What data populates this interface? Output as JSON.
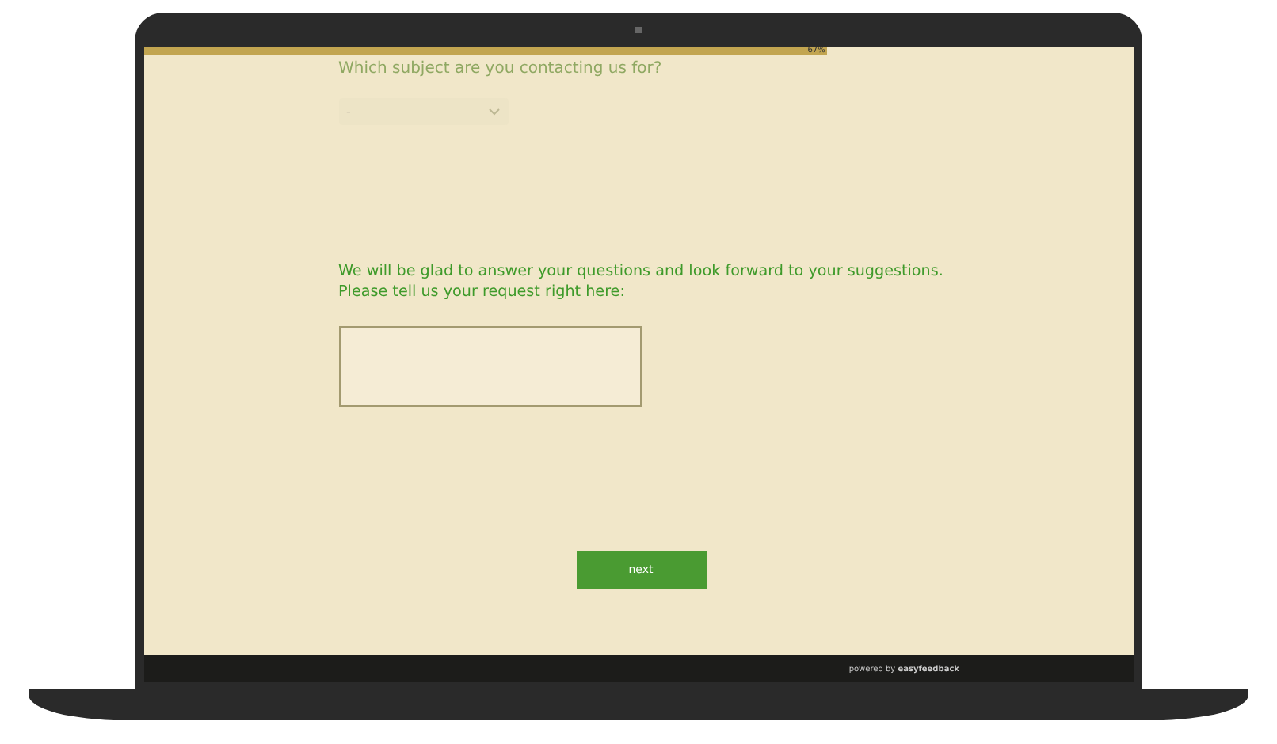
{
  "progress": {
    "level": 0.69,
    "label": "67%"
  },
  "question": "Which subject are you contacting us for?",
  "subject_select": {
    "value": "-",
    "disabled": true
  },
  "prompt": [
    "We will be glad to answer your questions and look forward to your suggestions.",
    "Please tell us your request right here:"
  ],
  "next_button": "next",
  "footer": "powered by **easyfeedback**"
}
